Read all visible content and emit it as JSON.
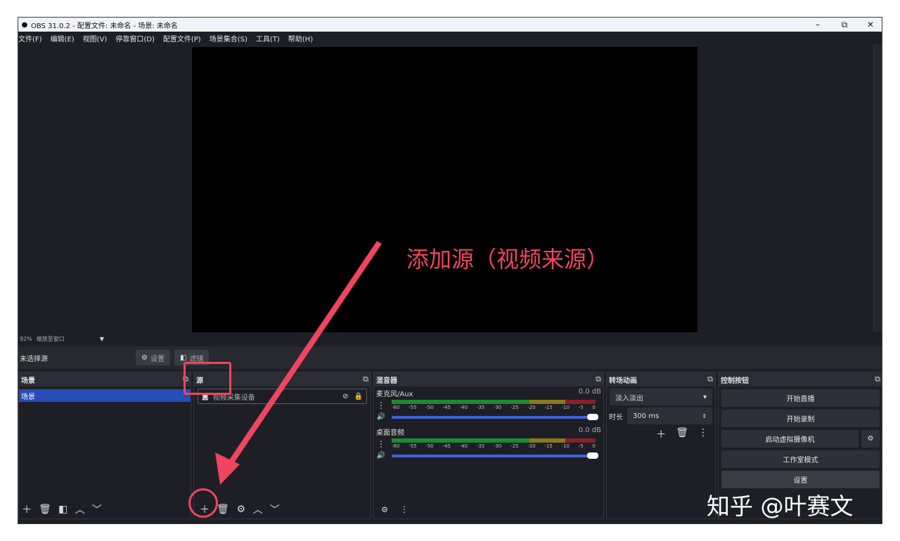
{
  "window": {
    "title": "OBS 31.0.2 - 配置文件: 未命名 - 场景: 未命名",
    "minimize": "–",
    "restore": "⧉",
    "close": "✕"
  },
  "menu": [
    "文件(F)",
    "编辑(E)",
    "视图(V)",
    "停靠窗口(D)",
    "配置文件(P)",
    "场景集合(S)",
    "工具(T)",
    "帮助(H)"
  ],
  "zoom": {
    "percent": "92%",
    "mode": "缩放至窗口",
    "arrow": "▼"
  },
  "source_toolbar": {
    "no_source": "未选择源",
    "settings": "设置",
    "filters": "滤镜"
  },
  "scenes": {
    "title": "场景",
    "items": [
      "场景"
    ]
  },
  "sources": {
    "title": "源",
    "items": [
      {
        "name": "视频采集设备"
      }
    ]
  },
  "mixer": {
    "title": "混音器",
    "channels": [
      {
        "name": "麦克风/Aux",
        "db": "0.0 dB"
      },
      {
        "name": "桌面音频",
        "db": "0.0 dB"
      }
    ],
    "scale": [
      "-60",
      "-55",
      "-50",
      "-45",
      "-40",
      "-35",
      "-30",
      "-25",
      "-20",
      "-15",
      "-10",
      "-5",
      "0"
    ]
  },
  "transitions": {
    "title": "转场动画",
    "selected": "淡入淡出",
    "duration_label": "时长",
    "duration": "300 ms"
  },
  "controls": {
    "title": "控制按钮",
    "buttons": [
      "开始直播",
      "开始录制",
      "启动虚拟摄像机",
      "工作室模式",
      "设置"
    ]
  },
  "annotation": "添加源（视频来源）",
  "watermark": "知乎 @叶赛文",
  "colors": {
    "highlight": "#f0455e",
    "selection": "#284cb8"
  }
}
